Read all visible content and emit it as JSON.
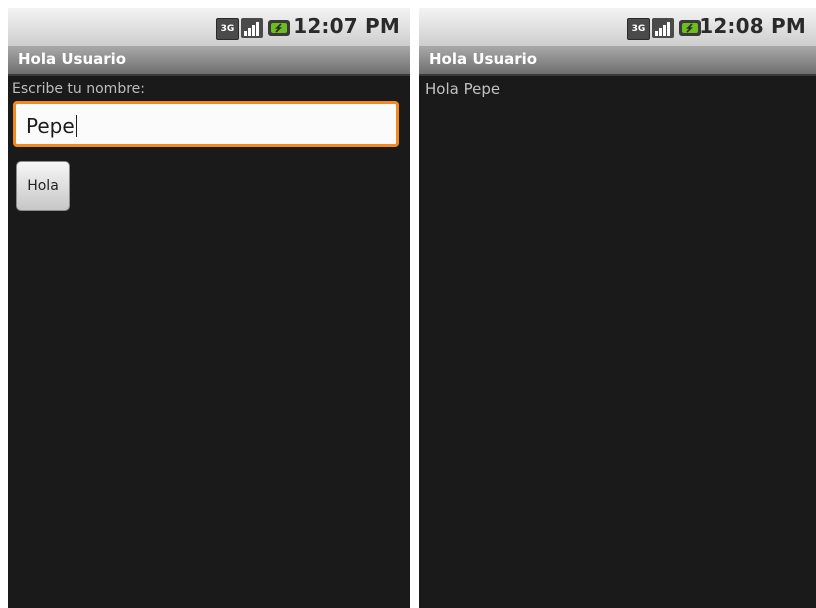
{
  "left_screen": {
    "status": {
      "time": "12:07 PM",
      "network_badge": "3G"
    },
    "title": "Hola Usuario",
    "prompt_label": "Escribe tu nombre:",
    "name_input_value": "Pepe",
    "button_label": "Hola"
  },
  "right_screen": {
    "status": {
      "time": "12:08 PM",
      "network_badge": "3G"
    },
    "title": "Hola Usuario",
    "greeting": "Hola Pepe"
  },
  "colors": {
    "screen_background": "#1a1a1a",
    "input_focus_border": "#f08a1e",
    "titlebar": "#8a8a8a",
    "battery_green": "#6cbd1f"
  },
  "icons": [
    "network-3g-icon",
    "signal-strength-icon",
    "battery-icon"
  ]
}
